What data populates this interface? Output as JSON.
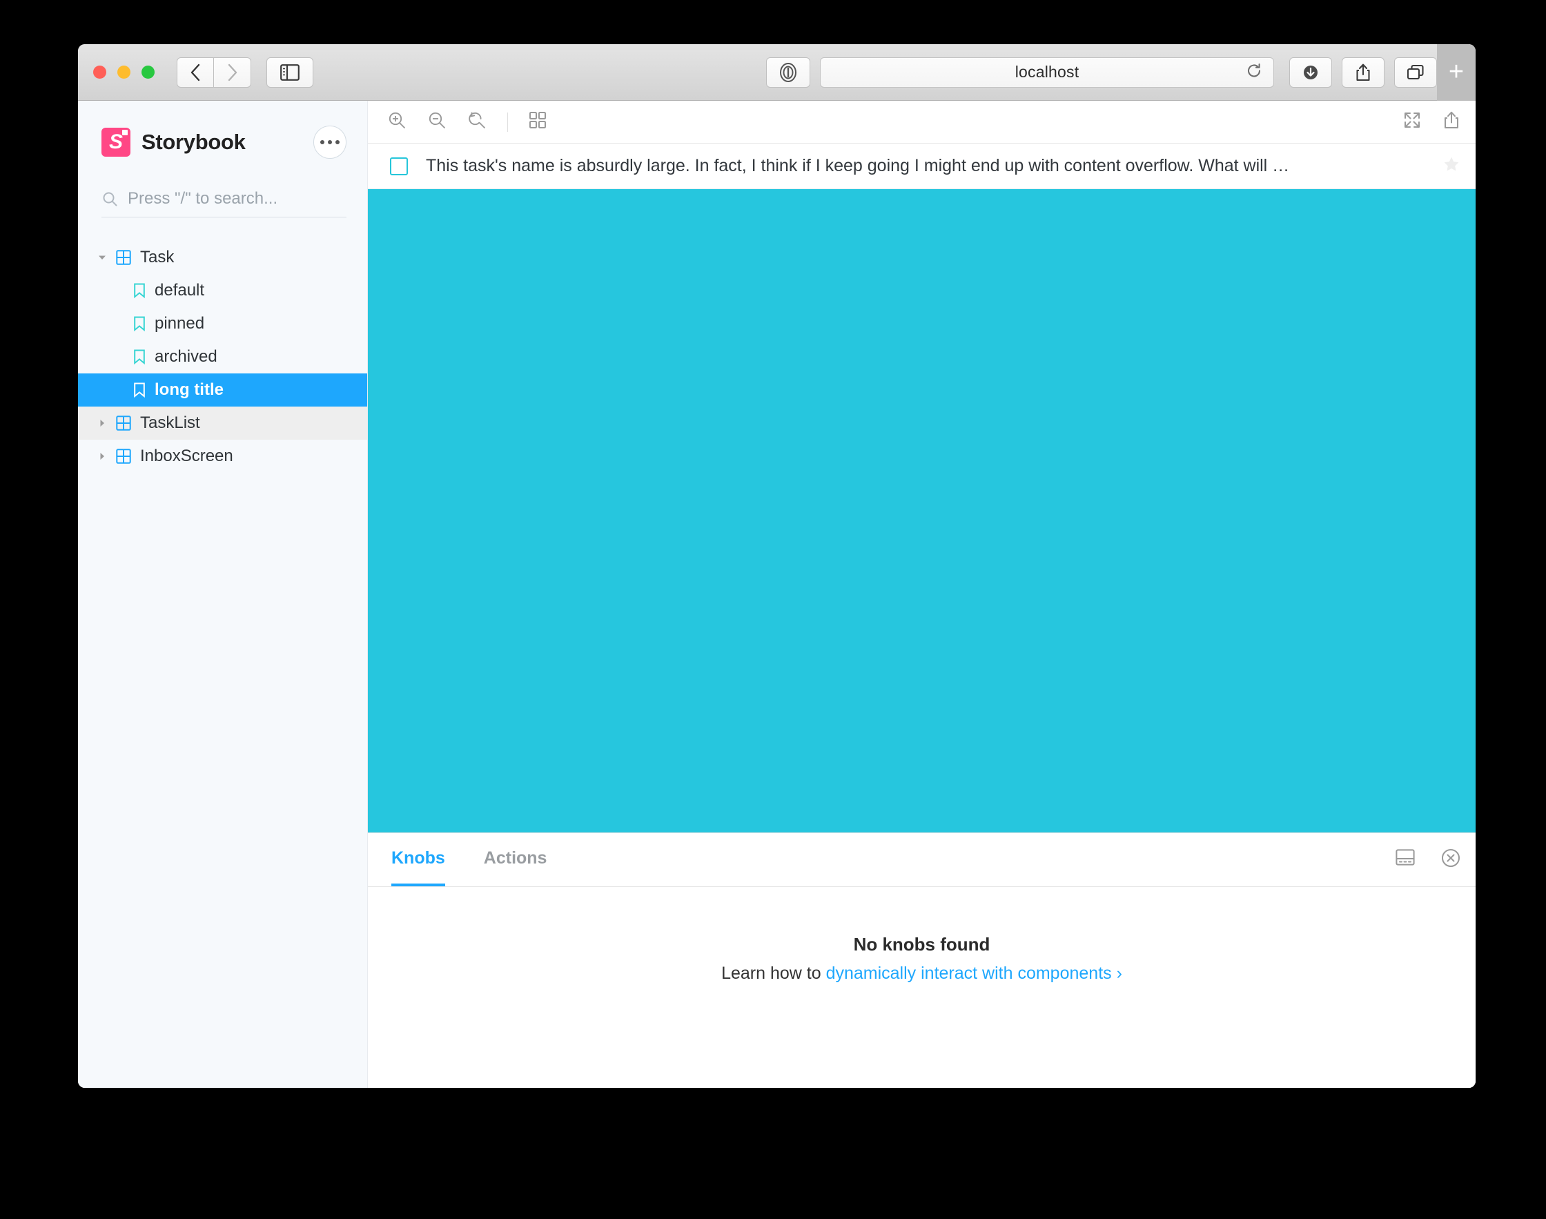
{
  "browser": {
    "url_text": "localhost",
    "traffic_lights": [
      "close",
      "minimize",
      "zoom"
    ],
    "back_label": "‹",
    "forward_label": "›",
    "new_tab_label": "+"
  },
  "sidebar": {
    "brand": {
      "logo_letter": "S",
      "name": "Storybook"
    },
    "menu_button_name": "more-menu",
    "search": {
      "placeholder": "Press \"/\" to search..."
    },
    "tree": [
      {
        "label": "Task",
        "type": "component",
        "depth": 0,
        "expanded": true,
        "state": "normal"
      },
      {
        "label": "default",
        "type": "story",
        "depth": 1,
        "state": "normal"
      },
      {
        "label": "pinned",
        "type": "story",
        "depth": 1,
        "state": "normal"
      },
      {
        "label": "archived",
        "type": "story",
        "depth": 1,
        "state": "normal"
      },
      {
        "label": "long title",
        "type": "story",
        "depth": 1,
        "state": "selected"
      },
      {
        "label": "TaskList",
        "type": "component",
        "depth": 0,
        "expanded": false,
        "state": "hovered"
      },
      {
        "label": "InboxScreen",
        "type": "component",
        "depth": 0,
        "expanded": false,
        "state": "normal"
      }
    ]
  },
  "preview": {
    "toolbar": [
      "zoom-in",
      "zoom-out",
      "zoom-reset",
      "grid-backgrounds",
      "fullscreen",
      "open-in-new"
    ],
    "story": {
      "task_title": "This task's name is absurdly large. In fact, I think if I keep going I might end up with content overflow. What will …",
      "checkbox_checked": false,
      "starred": false
    },
    "canvas_color": "#26c6de"
  },
  "addons": {
    "tabs": [
      {
        "label": "Knobs",
        "active": true
      },
      {
        "label": "Actions",
        "active": false
      }
    ],
    "panel_actions": [
      "panel-position",
      "close-panel"
    ],
    "empty_state": {
      "title": "No knobs found",
      "prefix": "Learn how to ",
      "link": "dynamically interact with components ›"
    }
  },
  "colors": {
    "accent_blue": "#1ea7fd",
    "brand_pink": "#ff4785",
    "canvas_cyan": "#26c6de",
    "sidebar_bg": "#f6f9fc"
  }
}
